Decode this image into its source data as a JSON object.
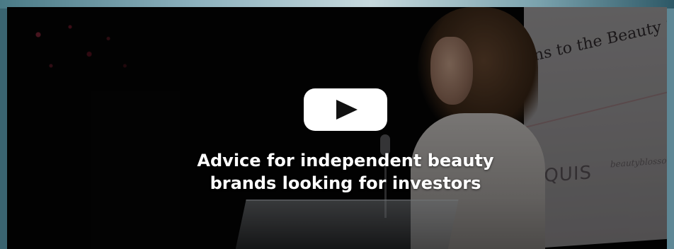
{
  "video": {
    "title_line1": "Advice for independent beauty",
    "title_line2": "brands looking for investors",
    "play_icon": "play-icon",
    "play_button_color": "#ffffff",
    "overlay_color": "#000000"
  },
  "thumbnail": {
    "banner_text": "ns to the Beauty Spotlig",
    "banner_logo_a": "AQUIS",
    "banner_logo_b": "beautyblossom"
  }
}
